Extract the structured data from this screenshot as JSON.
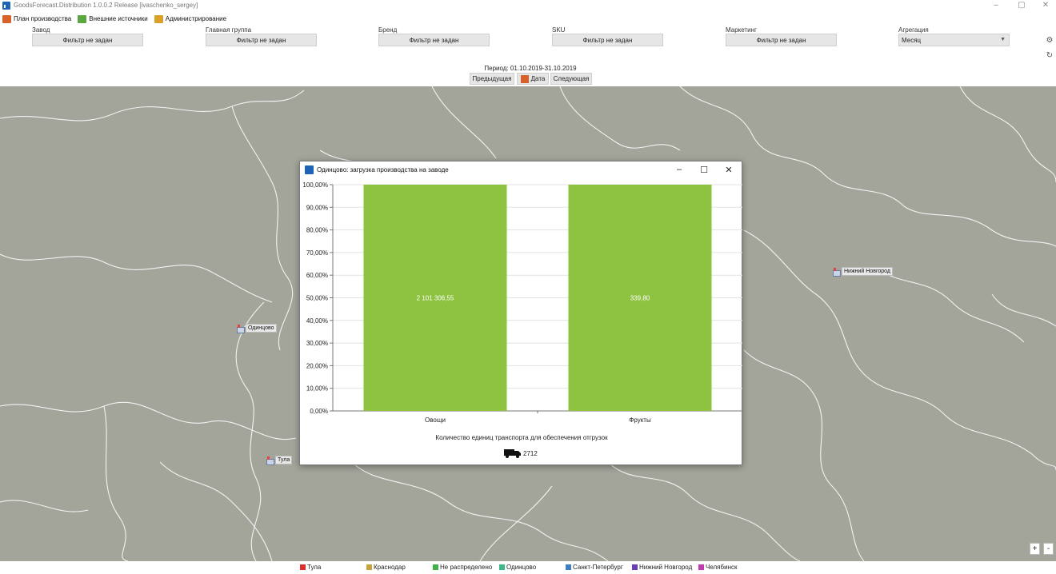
{
  "window": {
    "title": "GoodsForecast.Distribution 1.0.0.2 Release [ivaschenko_sergey]",
    "minimize": "–",
    "maximize": "▢",
    "close": "✕"
  },
  "menu": [
    {
      "label": "План производства",
      "icon": "calendar-icon",
      "color": "#d9602b"
    },
    {
      "label": "Внешние источники",
      "icon": "database-sync-icon",
      "color": "#5aa640"
    },
    {
      "label": "Администрирование",
      "icon": "users-admin-icon",
      "color": "#d8a12a"
    }
  ],
  "filters": [
    {
      "label": "Завод",
      "value": "Фильтр не задан"
    },
    {
      "label": "Главная группа",
      "value": "Фильтр не задан"
    },
    {
      "label": "Бренд",
      "value": "Фильтр не задан"
    },
    {
      "label": "SKU",
      "value": "Фильтр не задан"
    },
    {
      "label": "Маркетинг",
      "value": "Фильтр не задан"
    }
  ],
  "aggregation": {
    "label": "Агрегация",
    "value": "Месяц"
  },
  "period": {
    "text": "Период: 01.10.2019-31.10.2019",
    "prev": "Предыдущая",
    "date": "Дата",
    "next": "Следующая"
  },
  "map": {
    "background": "#a3a59b",
    "cities": [
      {
        "name": "Одинцово"
      },
      {
        "name": "Тула"
      },
      {
        "name": "Нижний Новгород"
      }
    ],
    "zoom_in": "+",
    "zoom_out": "-"
  },
  "legend": [
    {
      "label": "Тула",
      "color": "#d9302c"
    },
    {
      "label": "Краснодар",
      "color": "#c9a23a"
    },
    {
      "label": "Не распределено",
      "color": "#3fb34a"
    },
    {
      "label": "Одинцово",
      "color": "#3cb88a"
    },
    {
      "label": "Санкт-Петербург",
      "color": "#3e7fc1"
    },
    {
      "label": "Нижний Новгород",
      "color": "#6a3fb5"
    },
    {
      "label": "Челябинск",
      "color": "#c33bb0"
    }
  ],
  "dialog": {
    "title": "Одинцово: загрузка производства на заводе",
    "minimize": "–",
    "maximize": "☐",
    "close": "✕",
    "transport_caption": "Количество единиц транспорта для обеспечения отгрузок",
    "transport_value": "2712"
  },
  "chart_data": {
    "type": "bar",
    "categories": [
      "Овощи",
      "Фрукты"
    ],
    "values": [
      100,
      100
    ],
    "data_labels": [
      "2 101 306,55",
      "339,80"
    ],
    "yticks": [
      "0,00%",
      "10,00%",
      "20,00%",
      "30,00%",
      "40,00%",
      "50,00%",
      "60,00%",
      "70,00%",
      "80,00%",
      "90,00%",
      "100,00%"
    ],
    "ylim": [
      0,
      100
    ],
    "bar_color": "#8dc341",
    "grid": true
  }
}
